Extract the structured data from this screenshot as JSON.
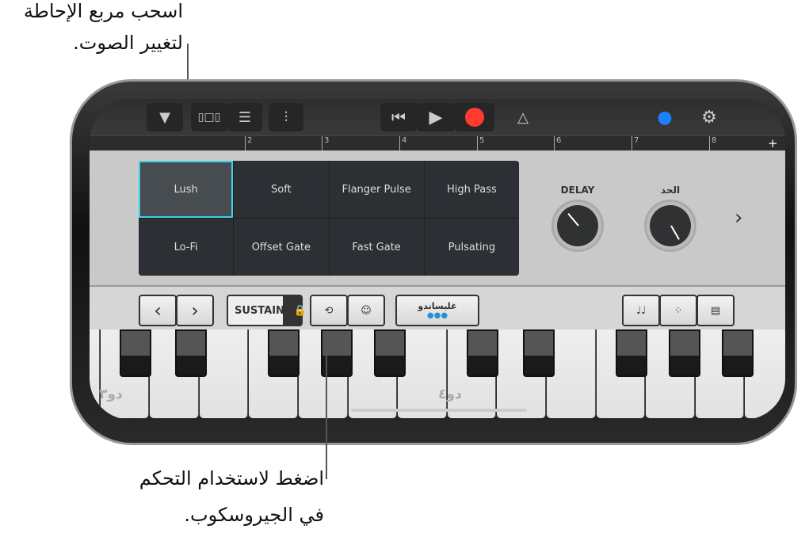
{
  "callouts": {
    "top_line1": "اسحب مربع الإحاطة",
    "top_line2": "لتغيير الصوت.",
    "bottom_line1": "اضغط لاستخدام التحكم",
    "bottom_line2": "في الجيروسكوب."
  },
  "toolbar": {
    "icons": [
      "triangle-down",
      "view-keyboard",
      "tracks",
      "mixer",
      "rewind",
      "play",
      "record",
      "metronome",
      "master-knob",
      "settings"
    ],
    "record_color": "#ff3b30",
    "accent": "#1a82ff"
  },
  "ruler": {
    "marks": [
      "2",
      "3",
      "4",
      "5",
      "6",
      "7",
      "8"
    ],
    "add": "+"
  },
  "sound_grid": {
    "cells": [
      "Lush",
      "Soft",
      "Flanger Pulse",
      "High Pass",
      "Lo-Fi",
      "Offset Gate",
      "Fast Gate",
      "Pulsating"
    ],
    "selected": "Lush"
  },
  "knobs": [
    {
      "label": "DELAY"
    },
    {
      "label": "الحد"
    }
  ],
  "next": "›",
  "controls": {
    "prev": "‹",
    "next": "›",
    "sustain": "SUSTAIN",
    "glissando": "غليساندو"
  },
  "keyboard": {
    "labels": [
      "دو٣",
      "دو٤"
    ]
  }
}
